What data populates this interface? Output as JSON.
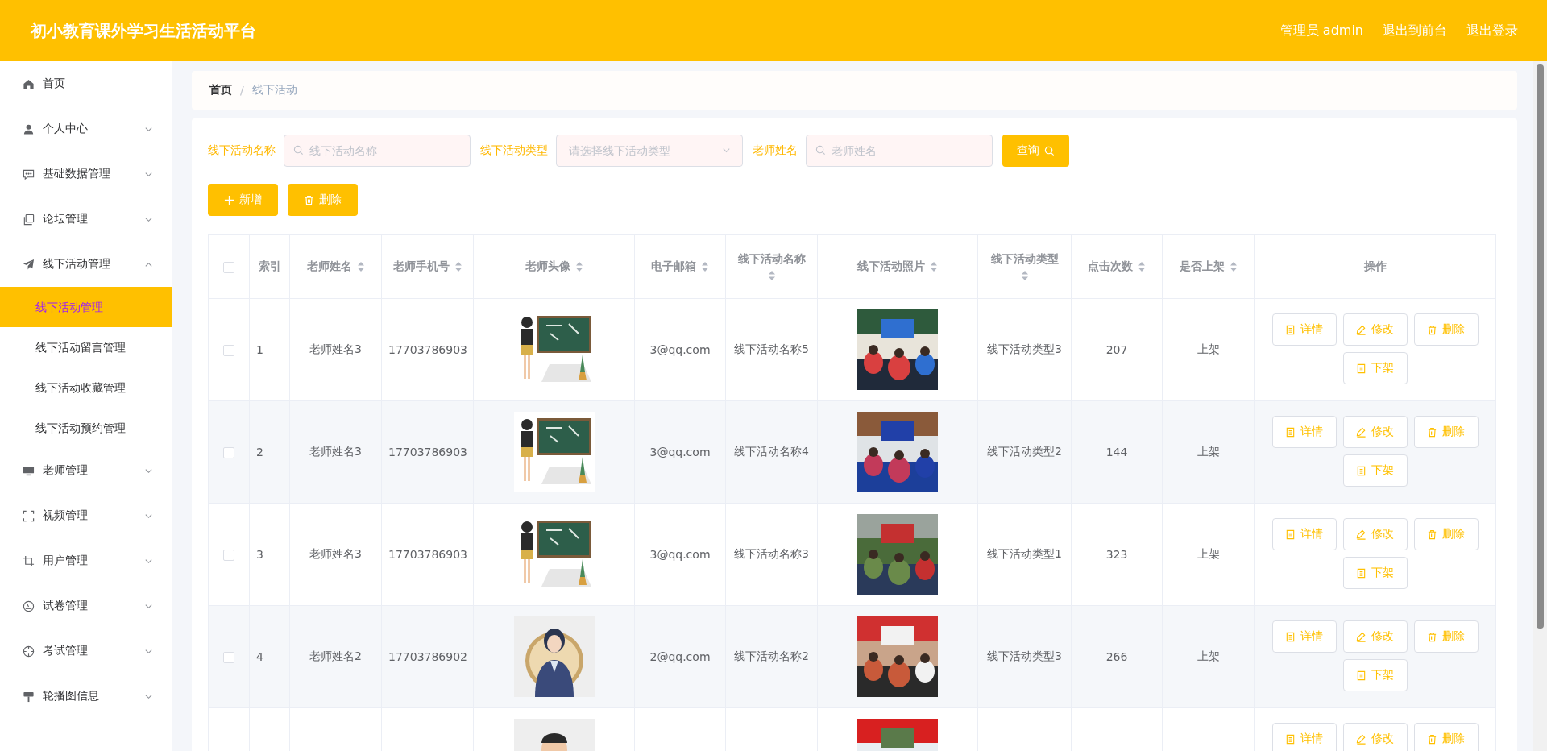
{
  "header": {
    "title": "初小教育课外学习生活活动平台",
    "links": [
      "管理员 admin",
      "退出到前台",
      "退出登录"
    ]
  },
  "sidebar": {
    "items": [
      {
        "label": "首页",
        "kind": "link"
      },
      {
        "label": "个人中心",
        "kind": "menu",
        "expanded": false
      },
      {
        "label": "基础数据管理",
        "kind": "menu",
        "expanded": false
      },
      {
        "label": "论坛管理",
        "kind": "menu",
        "expanded": false
      },
      {
        "label": "线下活动管理",
        "kind": "menu",
        "expanded": true,
        "children": [
          {
            "label": "线下活动管理",
            "selected": true
          },
          {
            "label": "线下活动留言管理",
            "selected": false
          },
          {
            "label": "线下活动收藏管理",
            "selected": false
          },
          {
            "label": "线下活动预约管理",
            "selected": false
          }
        ]
      },
      {
        "label": "老师管理",
        "kind": "menu",
        "expanded": false
      },
      {
        "label": "视频管理",
        "kind": "menu",
        "expanded": false
      },
      {
        "label": "用户管理",
        "kind": "menu",
        "expanded": false
      },
      {
        "label": "试卷管理",
        "kind": "menu",
        "expanded": false
      },
      {
        "label": "考试管理",
        "kind": "menu",
        "expanded": false
      },
      {
        "label": "轮播图信息",
        "kind": "menu",
        "expanded": false
      }
    ]
  },
  "breadcrumb": {
    "separator": "/",
    "items": [
      "首页",
      "线下活动"
    ]
  },
  "search": {
    "fields": [
      {
        "label": "线下活动名称",
        "kind": "text",
        "placeholder": "线下活动名称"
      },
      {
        "label": "线下活动类型",
        "kind": "select",
        "placeholder": "请选择线下活动类型"
      },
      {
        "label": "老师姓名",
        "kind": "text",
        "placeholder": "老师姓名"
      }
    ],
    "query_button": "查询"
  },
  "toolbar": [
    {
      "label": "新增",
      "kind": "add"
    },
    {
      "label": "删除",
      "kind": "delete"
    }
  ],
  "table": {
    "select_all_checked": false,
    "columns": [
      {
        "label": "索引",
        "sortable": false
      },
      {
        "label": "老师姓名",
        "sortable": true
      },
      {
        "label": "老师手机号",
        "sortable": true
      },
      {
        "label": "老师头像",
        "sortable": true
      },
      {
        "label": "电子邮箱",
        "sortable": true
      },
      {
        "label": "线下活动名称",
        "sortable": true
      },
      {
        "label": "线下活动照片",
        "sortable": true
      },
      {
        "label": "线下活动类型",
        "sortable": true
      },
      {
        "label": "点击次数",
        "sortable": true
      },
      {
        "label": "是否上架",
        "sortable": true
      },
      {
        "label": "操作",
        "sortable": false
      }
    ],
    "rows": [
      {
        "checked": false,
        "index": "1",
        "teacher_name": "老师姓名3",
        "phone": "17703786903",
        "avatar": {
          "kind": "picture"
        },
        "email": "3@qq.com",
        "activity_name": "线下活动名称5",
        "photo": {
          "kind": "picture"
        },
        "activity_type": "线下活动类型3",
        "clicks": "207",
        "status": "上架",
        "actions": [
          {
            "label": "详情",
            "kind": "detail"
          },
          {
            "label": "修改",
            "kind": "edit"
          },
          {
            "label": "删除",
            "kind": "delete"
          },
          {
            "label": "下架",
            "kind": "unpublish"
          }
        ]
      },
      {
        "checked": false,
        "index": "2",
        "teacher_name": "老师姓名3",
        "phone": "17703786903",
        "avatar": {
          "kind": "picture"
        },
        "email": "3@qq.com",
        "activity_name": "线下活动名称4",
        "photo": {
          "kind": "picture"
        },
        "activity_type": "线下活动类型2",
        "clicks": "144",
        "status": "上架",
        "actions": [
          {
            "label": "详情",
            "kind": "detail"
          },
          {
            "label": "修改",
            "kind": "edit"
          },
          {
            "label": "删除",
            "kind": "delete"
          },
          {
            "label": "下架",
            "kind": "unpublish"
          }
        ]
      },
      {
        "checked": false,
        "index": "3",
        "teacher_name": "老师姓名3",
        "phone": "17703786903",
        "avatar": {
          "kind": "picture"
        },
        "email": "3@qq.com",
        "activity_name": "线下活动名称3",
        "photo": {
          "kind": "picture"
        },
        "activity_type": "线下活动类型1",
        "clicks": "323",
        "status": "上架",
        "actions": [
          {
            "label": "详情",
            "kind": "detail"
          },
          {
            "label": "修改",
            "kind": "edit"
          },
          {
            "label": "删除",
            "kind": "delete"
          },
          {
            "label": "下架",
            "kind": "unpublish"
          }
        ]
      },
      {
        "checked": false,
        "index": "4",
        "teacher_name": "老师姓名2",
        "phone": "17703786902",
        "avatar": {
          "kind": "picture"
        },
        "email": "2@qq.com",
        "activity_name": "线下活动名称2",
        "photo": {
          "kind": "picture"
        },
        "activity_type": "线下活动类型3",
        "clicks": "266",
        "status": "上架",
        "actions": [
          {
            "label": "详情",
            "kind": "detail"
          },
          {
            "label": "修改",
            "kind": "edit"
          },
          {
            "label": "删除",
            "kind": "delete"
          },
          {
            "label": "下架",
            "kind": "unpublish"
          }
        ]
      },
      {
        "avatar": {
          "kind": "picture"
        },
        "photo": {
          "kind": "picture"
        },
        "actions": [
          {
            "label": "详情",
            "kind": "detail"
          },
          {
            "label": "修改",
            "kind": "edit"
          },
          {
            "label": "删除",
            "kind": "delete"
          }
        ]
      }
    ]
  }
}
